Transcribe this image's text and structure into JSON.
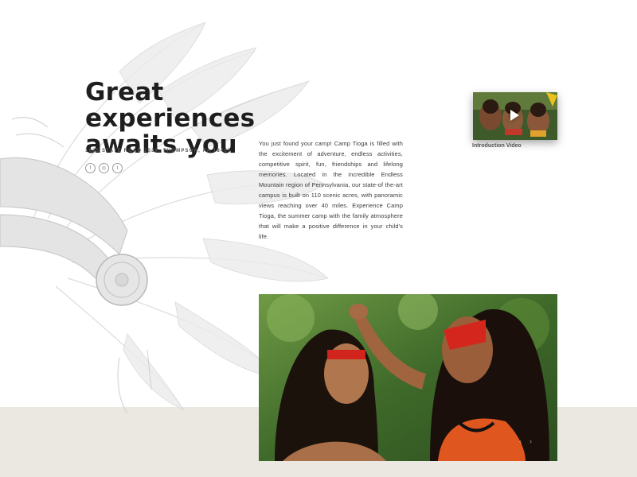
{
  "hero": {
    "title_line1": "Great experiences",
    "title_line2": "awaits you",
    "address": "1635 State Road 2036, Thompson, PA 18465"
  },
  "socials": {
    "facebook_glyph": "f",
    "instagram_glyph": "◎",
    "twitter_glyph": "t"
  },
  "intro": {
    "text": "You just found your camp! Camp Tioga is filled with the excitement of adventure, endless activities, competitive spirit, fun, friendships and lifelong memories. Located in the incredible Endless Mountain region of Pennsylvania, our state-of the-art campus is built on 110 scenic acres, with panoramic views reaching over 40 miles. Experience Camp Tioga, the summer camp with the family atmosphere that will make a positive difference in your child's life."
  },
  "video": {
    "label": "Introduction Video"
  },
  "slider": {
    "prev_glyph": "‹",
    "next_glyph": "›"
  },
  "colors": {
    "background": "#ffffff",
    "band": "#ebe8e2",
    "title": "#1e1e1e",
    "body_text": "#3a3a3a"
  },
  "icons": [
    "facebook-icon",
    "instagram-icon",
    "twitter-icon",
    "play-icon",
    "chevron-left-icon",
    "chevron-right-icon"
  ]
}
